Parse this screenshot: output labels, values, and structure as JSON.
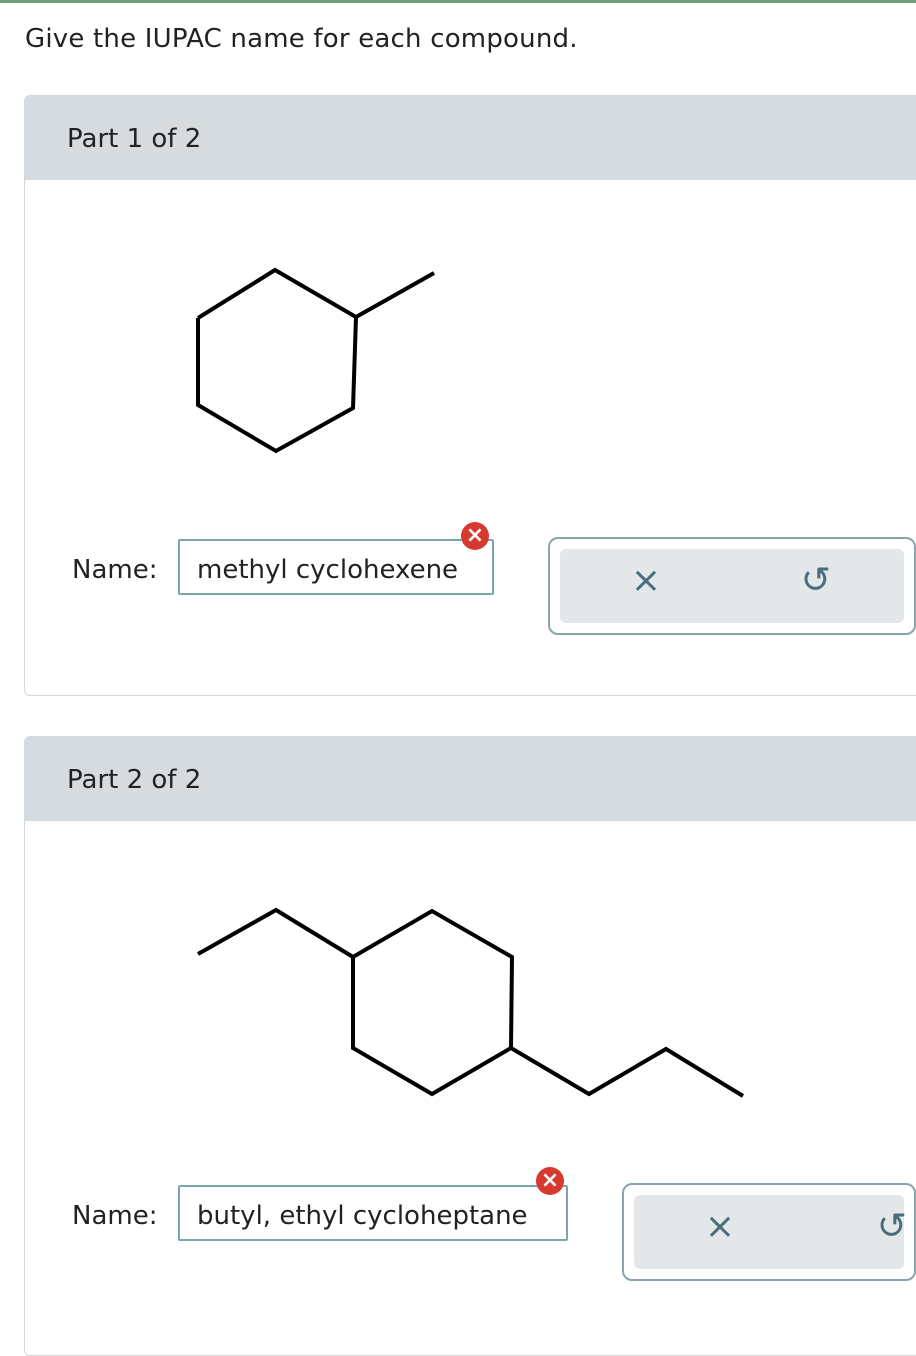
{
  "instruction": "Give the IUPAC name for each compound.",
  "parts": [
    {
      "title": "Part 1 of 2",
      "name_label": "Name:",
      "answer": "methyl cyclohexene",
      "answer_status": "incorrect"
    },
    {
      "title": "Part 2 of 2",
      "name_label": "Name:",
      "answer": "butyl, ethyl cycloheptane",
      "answer_status": "incorrect"
    }
  ],
  "icons": {
    "error": "×",
    "clear": "×",
    "reset": "↺"
  },
  "colors": {
    "header_bg": "#d5dbde",
    "error_red": "#d63a2f",
    "input_border": "#7aa6ad",
    "toolbar_icon": "#4a6d7c",
    "top_bar": "#6fa27c"
  }
}
